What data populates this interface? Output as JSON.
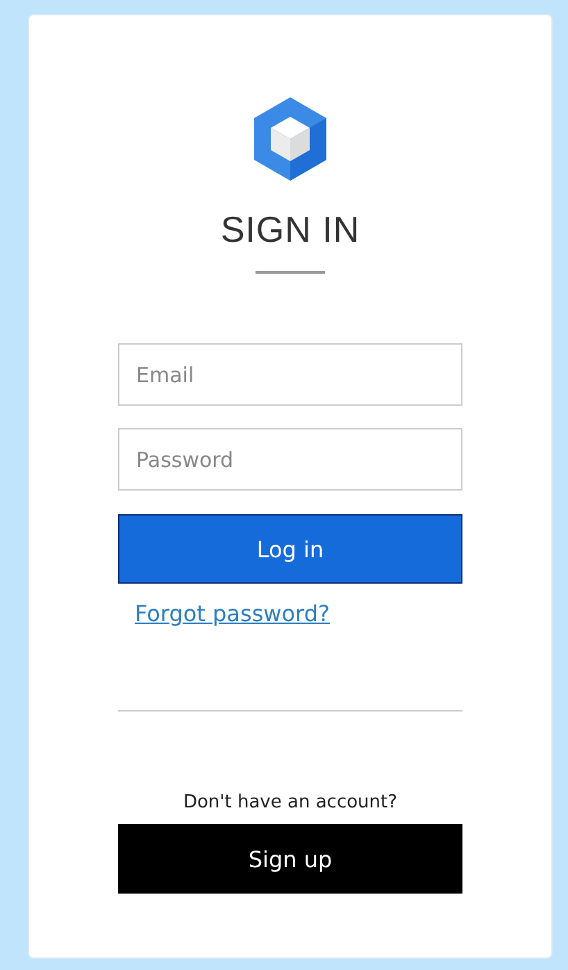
{
  "title": "SIGN IN",
  "fields": [
    {
      "placeholder": "Email"
    },
    {
      "placeholder": "Password"
    }
  ],
  "login_button": "Log in",
  "forgot_link": "Forgot password?",
  "signup_prompt": "Don't have an account?",
  "signup_button": "Sign up"
}
